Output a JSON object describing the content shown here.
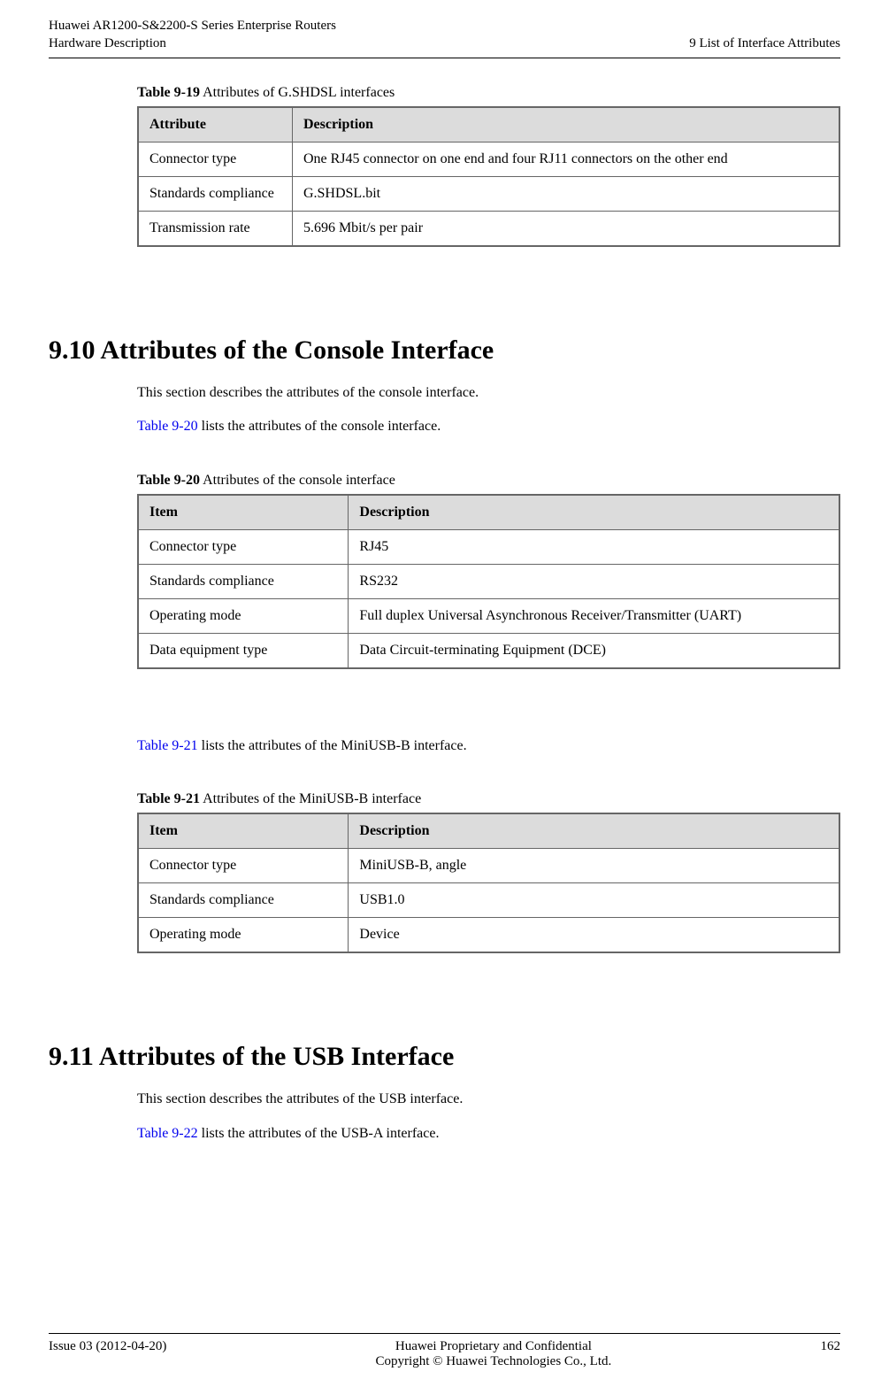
{
  "header": {
    "left_line1": "Huawei AR1200-S&2200-S Series Enterprise Routers",
    "left_line2": "Hardware Description",
    "right": "9 List of Interface Attributes"
  },
  "table919": {
    "caption_bold": "Table 9-19",
    "caption_rest": " Attributes of G.SHDSL interfaces",
    "head_attr": "Attribute",
    "head_desc": "Description",
    "rows": [
      {
        "attr": "Connector type",
        "desc": "One RJ45 connector on one end and four RJ11 connectors on the other end"
      },
      {
        "attr": "Standards compliance",
        "desc": "G.SHDSL.bit"
      },
      {
        "attr": "Transmission rate",
        "desc": "5.696 Mbit/s per pair"
      }
    ]
  },
  "section910": {
    "heading": "9.10 Attributes of the Console Interface",
    "intro": "This section describes the attributes of the console interface.",
    "ref_link": "Table 9-20",
    "ref_rest": " lists the attributes of the console interface."
  },
  "table920": {
    "caption_bold": "Table 9-20",
    "caption_rest": " Attributes of the console interface",
    "head_item": "Item",
    "head_desc": "Description",
    "rows": [
      {
        "item": "Connector type",
        "desc": "RJ45"
      },
      {
        "item": "Standards compliance",
        "desc": "RS232"
      },
      {
        "item": "Operating mode",
        "desc": "Full duplex Universal Asynchronous Receiver/Transmitter (UART)"
      },
      {
        "item": "Data equipment type",
        "desc": "Data Circuit-terminating Equipment (DCE)"
      }
    ]
  },
  "para921": {
    "ref_link": "Table 9-21",
    "ref_rest": " lists the attributes of the MiniUSB-B interface."
  },
  "table921": {
    "caption_bold": "Table 9-21",
    "caption_rest": " Attributes of the MiniUSB-B interface",
    "head_item": "Item",
    "head_desc": "Description",
    "rows": [
      {
        "item": "Connector type",
        "desc": "MiniUSB-B, angle"
      },
      {
        "item": "Standards compliance",
        "desc": "USB1.0"
      },
      {
        "item": "Operating mode",
        "desc": "Device"
      }
    ]
  },
  "section911": {
    "heading": "9.11 Attributes of the USB Interface",
    "intro": "This section describes the attributes of the USB interface.",
    "ref_link": "Table 9-22",
    "ref_rest": " lists the attributes of the USB-A interface."
  },
  "footer": {
    "left": "Issue 03 (2012-04-20)",
    "center_line1": "Huawei Proprietary and Confidential",
    "center_line2": "Copyright © Huawei Technologies Co., Ltd.",
    "right": "162"
  }
}
